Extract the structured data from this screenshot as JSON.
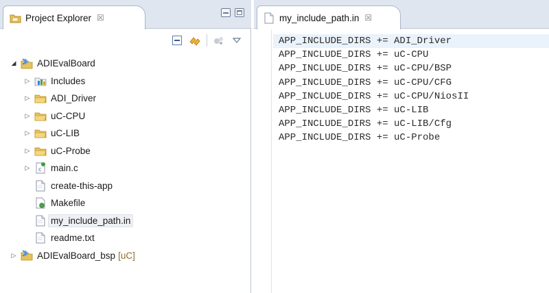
{
  "explorer": {
    "tab_title": "Project Explorer",
    "tab_close": "☒",
    "tree": [
      {
        "label": "ADIEvalBoard",
        "suffix": "",
        "icon": "project-icon",
        "depth": 0,
        "twisty": "open"
      },
      {
        "label": "Includes",
        "suffix": "",
        "icon": "includes-icon",
        "depth": 1,
        "twisty": "closed"
      },
      {
        "label": "ADI_Driver",
        "suffix": "",
        "icon": "folder-icon",
        "depth": 1,
        "twisty": "closed"
      },
      {
        "label": "uC-CPU",
        "suffix": "",
        "icon": "folder-icon",
        "depth": 1,
        "twisty": "closed"
      },
      {
        "label": "uC-LIB",
        "suffix": "",
        "icon": "folder-icon",
        "depth": 1,
        "twisty": "closed"
      },
      {
        "label": "uC-Probe",
        "suffix": "",
        "icon": "folder-icon",
        "depth": 1,
        "twisty": "closed"
      },
      {
        "label": "main.c",
        "suffix": "",
        "icon": "c-file-icon",
        "depth": 1,
        "twisty": "closed"
      },
      {
        "label": "create-this-app",
        "suffix": "",
        "icon": "file-icon",
        "depth": 1,
        "twisty": "none"
      },
      {
        "label": "Makefile",
        "suffix": "",
        "icon": "makefile-icon",
        "depth": 1,
        "twisty": "none"
      },
      {
        "label": "my_include_path.in",
        "suffix": "",
        "icon": "file-icon",
        "depth": 1,
        "twisty": "none",
        "selected": true
      },
      {
        "label": "readme.txt",
        "suffix": "",
        "icon": "file-icon",
        "depth": 1,
        "twisty": "none"
      },
      {
        "label": "ADIEvalBoard_bsp",
        "suffix": "[uC]",
        "icon": "project-icon",
        "depth": 0,
        "twisty": "closed"
      }
    ]
  },
  "editor": {
    "tab_title": "my_include_path.in",
    "tab_close": "☒",
    "lines": [
      "APP_INCLUDE_DIRS += ADI_Driver",
      "APP_INCLUDE_DIRS += uC-CPU",
      "APP_INCLUDE_DIRS += uC-CPU/BSP",
      "APP_INCLUDE_DIRS += uC-CPU/CFG",
      "APP_INCLUDE_DIRS += uC-CPU/NiosII",
      "APP_INCLUDE_DIRS += uC-LIB",
      "APP_INCLUDE_DIRS += uC-LIB/Cfg",
      "APP_INCLUDE_DIRS += uC-Probe"
    ]
  },
  "colors": {
    "folder": "#e8c25a",
    "folder_dark": "#c99a2a",
    "project_blue": "#3f7fcf",
    "current_line": "#eaf2fb"
  }
}
